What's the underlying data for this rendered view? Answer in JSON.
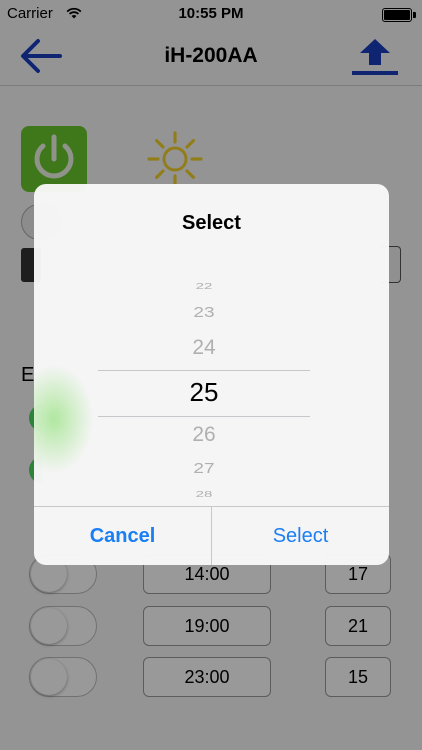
{
  "status_bar": {
    "carrier": "Carrier",
    "time": "10:55 PM"
  },
  "nav": {
    "title": "iH-200AA",
    "back_icon": "back-arrow-icon",
    "upload_icon": "upload-icon",
    "accent_color": "#1a3fbf"
  },
  "background": {
    "power_color": "#6ac72d",
    "sun_color": "#f2d22e",
    "section_label": "E",
    "schedule": [
      {
        "time": "14:00",
        "temp": "17",
        "enabled": false
      },
      {
        "time": "19:00",
        "temp": "21",
        "enabled": false
      },
      {
        "time": "23:00",
        "temp": "15",
        "enabled": false
      }
    ]
  },
  "alert": {
    "title": "Select",
    "picker_values": [
      "22",
      "23",
      "24",
      "25",
      "26",
      "27",
      "28"
    ],
    "selected_value": "25",
    "cancel_label": "Cancel",
    "select_label": "Select",
    "button_color": "#1a7ef5"
  }
}
